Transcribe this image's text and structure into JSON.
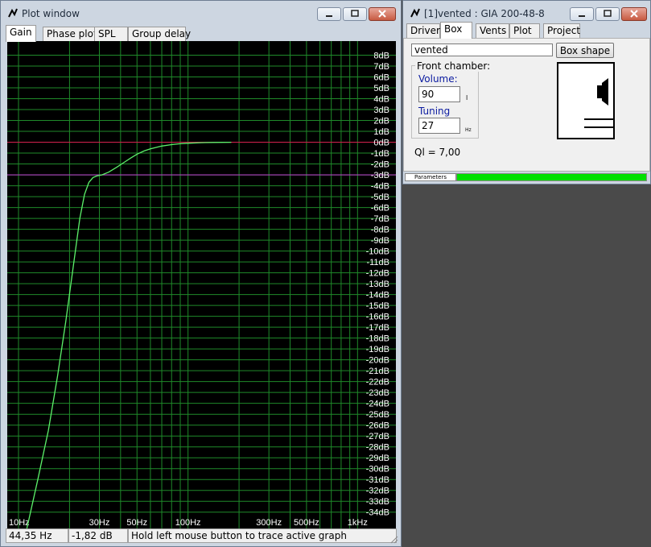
{
  "plot_window": {
    "title": "Plot window",
    "tabs": [
      {
        "label": "Gain"
      },
      {
        "label": "Phase plot"
      },
      {
        "label": "SPL"
      },
      {
        "label": "Group delay"
      }
    ],
    "status": {
      "frequency": "44,35 Hz",
      "gain": "-1,82 dB",
      "message": "Hold left mouse button to trace active graph"
    }
  },
  "box_window": {
    "title": "[1]vented : GIA 200-48-8",
    "tabs": [
      {
        "label": "Driver"
      },
      {
        "label": "Box"
      },
      {
        "label": "Vents"
      },
      {
        "label": "Plot"
      },
      {
        "label": "Project"
      }
    ],
    "box_type_value": "vented",
    "box_shape_label": "Box shape",
    "front_chamber_label": "Front chamber:",
    "volume_label": "Volume:",
    "volume_value": "90",
    "volume_unit": "l",
    "tuning_label": "Tuning freq.:",
    "tuning_value": "27",
    "tuning_unit": "Hz",
    "ql_text": "Ql = 7,00",
    "parameters_tab_label": "Parameters",
    "progress_fraction": 1.0
  },
  "colors": {
    "grid": "#1f8a2a",
    "curve": "#5cf06a",
    "zero_line": "#c8204a",
    "minus3_line": "#b040c0",
    "plot_bg": "#000000",
    "progress": "#00e000"
  },
  "chart_data": {
    "type": "line",
    "title": "",
    "xlabel": "",
    "ylabel": "",
    "x_scale": "log",
    "xlim": [
      10,
      1200
    ],
    "ylim": [
      -35.5,
      9
    ],
    "grid": true,
    "x_ticks": [
      {
        "value": 10,
        "label": "10Hz"
      },
      {
        "value": 30,
        "label": "30Hz"
      },
      {
        "value": 50,
        "label": "50Hz"
      },
      {
        "value": 100,
        "label": "100Hz"
      },
      {
        "value": 300,
        "label": "300Hz"
      },
      {
        "value": 500,
        "label": "500Hz"
      },
      {
        "value": 1000,
        "label": "1kHz"
      }
    ],
    "x_minor_grid": [
      20,
      40,
      60,
      70,
      80,
      90,
      200,
      400,
      600,
      700,
      800,
      900
    ],
    "y_ticks": [
      {
        "value": 8,
        "label": "8dB"
      },
      {
        "value": 7,
        "label": "7dB"
      },
      {
        "value": 6,
        "label": "6dB"
      },
      {
        "value": 5,
        "label": "5dB"
      },
      {
        "value": 4,
        "label": "4dB"
      },
      {
        "value": 3,
        "label": "3dB"
      },
      {
        "value": 2,
        "label": "2dB"
      },
      {
        "value": 1,
        "label": "1dB"
      },
      {
        "value": 0,
        "label": "0dB"
      },
      {
        "value": -1,
        "label": "-1dB"
      },
      {
        "value": -2,
        "label": "-2dB"
      },
      {
        "value": -3,
        "label": "-3dB"
      },
      {
        "value": -4,
        "label": "-4dB"
      },
      {
        "value": -5,
        "label": "-5dB"
      },
      {
        "value": -6,
        "label": "-6dB"
      },
      {
        "value": -7,
        "label": "-7dB"
      },
      {
        "value": -8,
        "label": "-8dB"
      },
      {
        "value": -9,
        "label": "-9dB"
      },
      {
        "value": -10,
        "label": "-10dB"
      },
      {
        "value": -11,
        "label": "-11dB"
      },
      {
        "value": -12,
        "label": "-12dB"
      },
      {
        "value": -13,
        "label": "-13dB"
      },
      {
        "value": -14,
        "label": "-14dB"
      },
      {
        "value": -15,
        "label": "-15dB"
      },
      {
        "value": -16,
        "label": "-16dB"
      },
      {
        "value": -17,
        "label": "-17dB"
      },
      {
        "value": -18,
        "label": "-18dB"
      },
      {
        "value": -19,
        "label": "-19dB"
      },
      {
        "value": -20,
        "label": "-20dB"
      },
      {
        "value": -21,
        "label": "-21dB"
      },
      {
        "value": -22,
        "label": "-22dB"
      },
      {
        "value": -23,
        "label": "-23dB"
      },
      {
        "value": -24,
        "label": "-24dB"
      },
      {
        "value": -25,
        "label": "-25dB"
      },
      {
        "value": -26,
        "label": "-26dB"
      },
      {
        "value": -27,
        "label": "-27dB"
      },
      {
        "value": -28,
        "label": "-28dB"
      },
      {
        "value": -29,
        "label": "-29dB"
      },
      {
        "value": -30,
        "label": "-30dB"
      },
      {
        "value": -31,
        "label": "-31dB"
      },
      {
        "value": -32,
        "label": "-32dB"
      },
      {
        "value": -33,
        "label": "-33dB"
      },
      {
        "value": -34,
        "label": "-34dB"
      }
    ],
    "reference_lines": [
      {
        "y": 0,
        "color": "zero_line"
      },
      {
        "y": -3,
        "color": "minus3_line"
      }
    ],
    "series": [
      {
        "x": [
          11.2,
          13,
          15,
          17,
          19,
          21,
          23,
          24.5,
          26,
          27.5,
          29,
          31,
          34,
          38,
          42,
          46,
          50,
          55,
          60,
          70,
          80,
          90,
          100,
          120,
          140,
          160,
          180
        ],
        "y": [
          -35.5,
          -31,
          -26.5,
          -21.5,
          -16.5,
          -11.5,
          -7,
          -4.8,
          -3.7,
          -3.25,
          -3.1,
          -3.0,
          -2.75,
          -2.3,
          -1.85,
          -1.45,
          -1.1,
          -0.8,
          -0.6,
          -0.35,
          -0.22,
          -0.14,
          -0.09,
          -0.04,
          -0.02,
          -0.01,
          0
        ]
      }
    ]
  }
}
